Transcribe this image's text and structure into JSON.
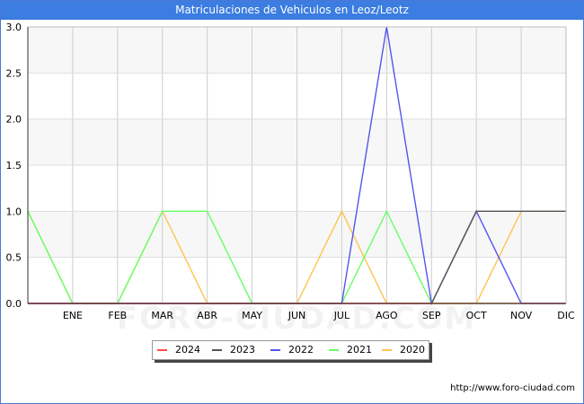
{
  "title": "Matriculaciones de Vehiculos en Leoz/Leotz",
  "source": "http://www.foro-ciudad.com",
  "watermark": "FORO-CIUDAD.COM",
  "chart_data": {
    "type": "line",
    "title": "Matriculaciones de Vehiculos en Leoz/Leotz",
    "xlabel": "",
    "ylabel": "",
    "categories": [
      "",
      "ENE",
      "FEB",
      "MAR",
      "ABR",
      "MAY",
      "JUN",
      "JUL",
      "AGO",
      "SEP",
      "OCT",
      "NOV",
      "DIC"
    ],
    "ylim": [
      0,
      3.0
    ],
    "yticks": [
      "0.0",
      "0.5",
      "1.0",
      "1.5",
      "2.0",
      "2.5",
      "3.0"
    ],
    "grid": true,
    "legend_position": "bottom",
    "series": [
      {
        "name": "2020",
        "color": "#ffc34d",
        "values": [
          1,
          0,
          0,
          1,
          0,
          0,
          0,
          1,
          0,
          0,
          0,
          1,
          1
        ]
      },
      {
        "name": "2021",
        "color": "#66ff66",
        "values": [
          1,
          0,
          0,
          1,
          1,
          0,
          0,
          0,
          1,
          0,
          0,
          0,
          0
        ]
      },
      {
        "name": "2022",
        "color": "#5555ee",
        "values": [
          0,
          0,
          0,
          0,
          0,
          0,
          0,
          0,
          3,
          0,
          1,
          0,
          0
        ]
      },
      {
        "name": "2023",
        "color": "#555555",
        "values": [
          0,
          0,
          0,
          0,
          0,
          0,
          0,
          0,
          0,
          0,
          1,
          1,
          1
        ]
      },
      {
        "name": "2024",
        "color": "#ff4d4d",
        "values": [
          0,
          0,
          0,
          0,
          0,
          0,
          0,
          0,
          0,
          0,
          0,
          0,
          0
        ]
      }
    ],
    "legend_order": [
      "2024",
      "2023",
      "2022",
      "2021",
      "2020"
    ]
  }
}
